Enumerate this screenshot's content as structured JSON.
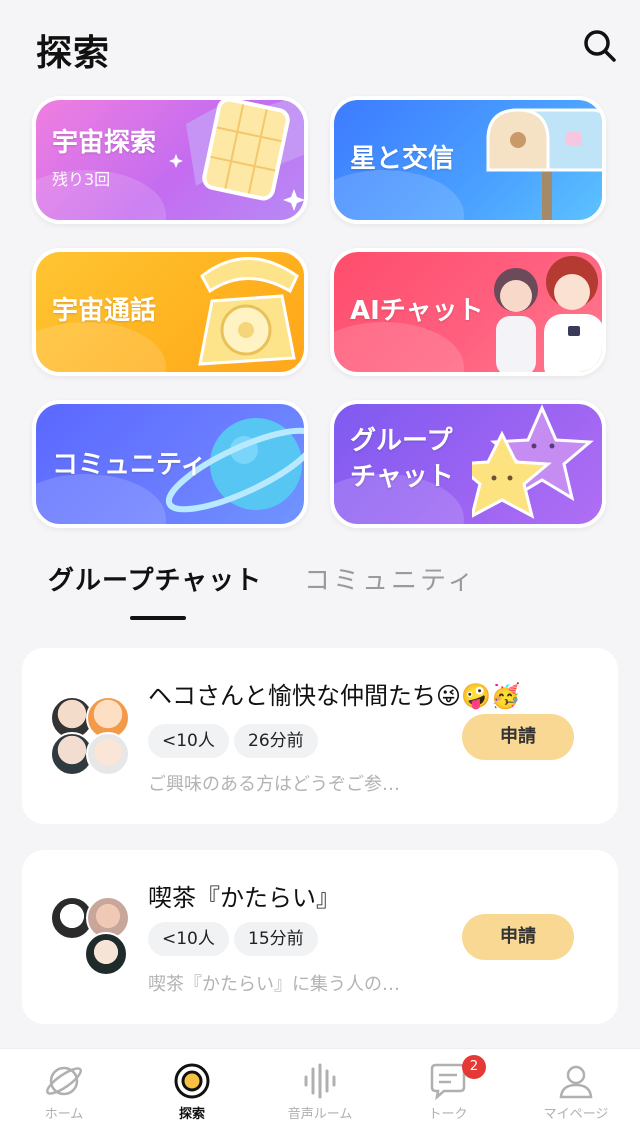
{
  "header": {
    "title": "探索"
  },
  "features": {
    "space_explore": {
      "label": "宇宙探索",
      "sub": "残り3回"
    },
    "star_mail": {
      "label": "星と交信"
    },
    "space_call": {
      "label": "宇宙通話"
    },
    "ai_chat": {
      "label": "AIチャット"
    },
    "community": {
      "label": "コミュニティ"
    },
    "group_chat": {
      "label_line1": "グループ",
      "label_line2": "チャット"
    }
  },
  "tabs": {
    "active": "グループチャット",
    "inactive": "コミュニティ"
  },
  "groups": [
    {
      "title": "ヘコさんと愉快な仲間たち😜🤪🥳",
      "members": "<10人",
      "time": "26分前",
      "desc": "ご興味のある方はどうぞご参…",
      "apply": "申請"
    },
    {
      "title": "喫茶『かたらい』",
      "members": "<10人",
      "time": "15分前",
      "desc": "喫茶『かたらい』に集う人の…",
      "apply": "申請"
    }
  ],
  "nav": {
    "home": "ホーム",
    "explore": "探索",
    "voice_room": "音声ルーム",
    "talk": "トーク",
    "talk_badge": "2",
    "mypage": "マイページ"
  }
}
